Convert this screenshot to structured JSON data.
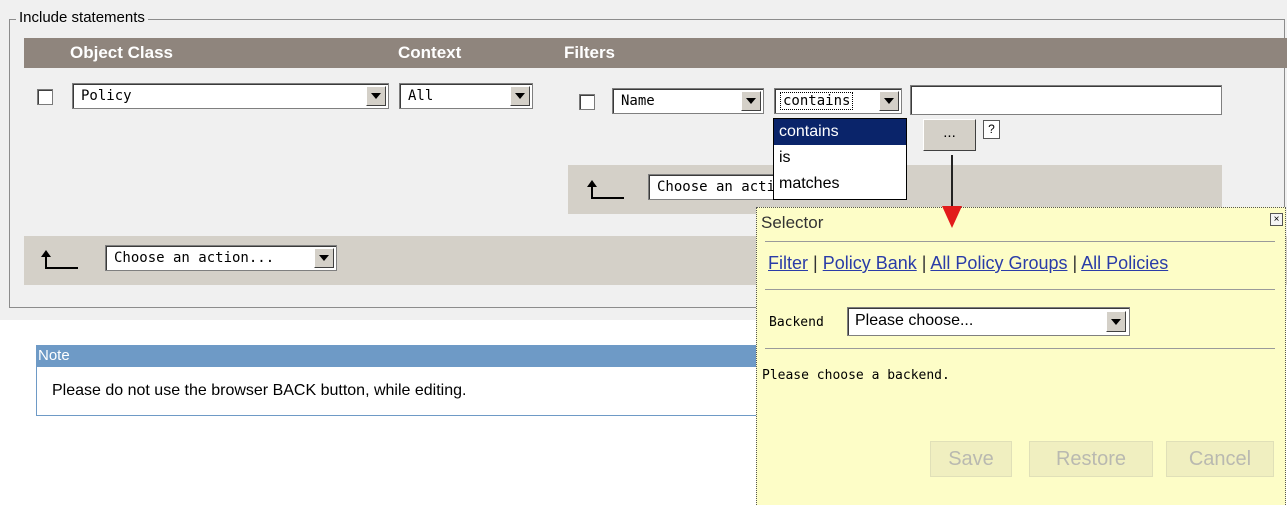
{
  "fieldset": {
    "legend": "Include statements"
  },
  "header": {
    "object_class": "Object Class",
    "context": "Context",
    "filters": "Filters"
  },
  "row": {
    "object_class_value": "Policy",
    "context_value": "All",
    "filter_field_value": "Name",
    "filter_operator_value": "contains",
    "filter_text_value": ""
  },
  "operator_options": [
    "contains",
    "is",
    "matches"
  ],
  "dots_button": "...",
  "help_icon": "?",
  "filter_action": {
    "value": "Choose an action..."
  },
  "main_action": {
    "value": "Choose an action..."
  },
  "note": {
    "title": "Note",
    "text": "Please do not use the browser BACK button, while editing."
  },
  "selector": {
    "title": "Selector",
    "close": "×",
    "links": [
      "Filter",
      "Policy Bank",
      "All Policy Groups",
      "All Policies"
    ],
    "backend_label": "Backend",
    "backend_value": "Please choose...",
    "message": "Please choose a backend.",
    "buttons": {
      "save": "Save",
      "restore": "Restore",
      "cancel": "Cancel"
    }
  },
  "colors": {
    "header": "#8f857d",
    "note_header": "#6e9ac6",
    "selector_bg": "#fdfdc7",
    "accent_arrow": "#e21b1b",
    "list_selection": "#0a246a"
  }
}
